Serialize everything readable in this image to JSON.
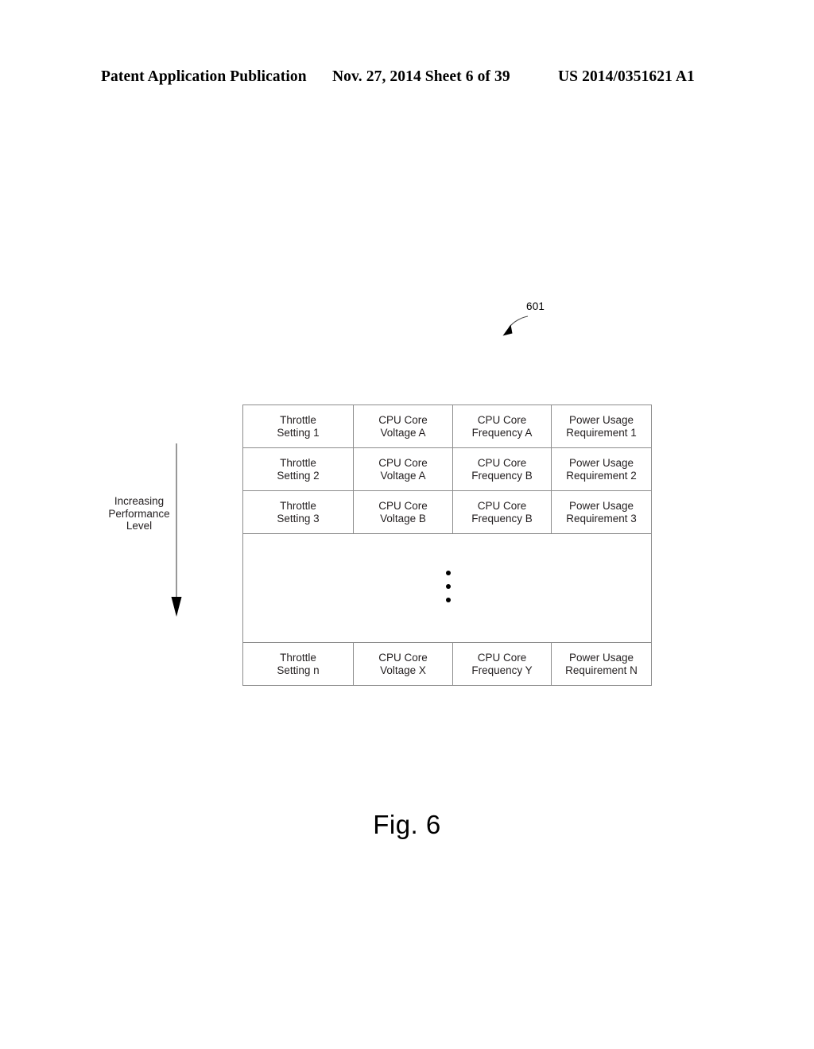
{
  "header": {
    "left": "Patent Application Publication",
    "middle": "Nov. 27, 2014  Sheet 6 of 39",
    "right": "US 2014/0351621 A1"
  },
  "figure": {
    "caption": "Fig. 6",
    "reference_numeral": "601",
    "annotation": {
      "line1": "Increasing",
      "line2": "Performance",
      "line3": "Level",
      "direction": "down"
    }
  },
  "table": {
    "rows": [
      {
        "throttle_l1": "Throttle",
        "throttle_l2": "Setting 1",
        "voltage_l1": "CPU Core",
        "voltage_l2": "Voltage A",
        "frequency_l1": "CPU Core",
        "frequency_l2": "Frequency A",
        "power_l1": "Power Usage",
        "power_l2": "Requirement 1"
      },
      {
        "throttle_l1": "Throttle",
        "throttle_l2": "Setting 2",
        "voltage_l1": "CPU Core",
        "voltage_l2": "Voltage A",
        "frequency_l1": "CPU Core",
        "frequency_l2": "Frequency B",
        "power_l1": "Power Usage",
        "power_l2": "Requirement 2"
      },
      {
        "throttle_l1": "Throttle",
        "throttle_l2": "Setting 3",
        "voltage_l1": "CPU Core",
        "voltage_l2": "Voltage B",
        "frequency_l1": "CPU Core",
        "frequency_l2": "Frequency B",
        "power_l1": "Power Usage",
        "power_l2": "Requirement 3"
      }
    ],
    "ellipsis": "vertical-ellipsis",
    "last_row": {
      "throttle_l1": "Throttle",
      "throttle_l2": "Setting n",
      "voltage_l1": "CPU Core",
      "voltage_l2": "Voltage X",
      "frequency_l1": "CPU Core",
      "frequency_l2": "Frequency Y",
      "power_l1": "Power Usage",
      "power_l2": "Requirement N"
    }
  },
  "colors": {
    "ink": "#231f20",
    "rule": "#8c8c8c",
    "page": "#ffffff"
  }
}
